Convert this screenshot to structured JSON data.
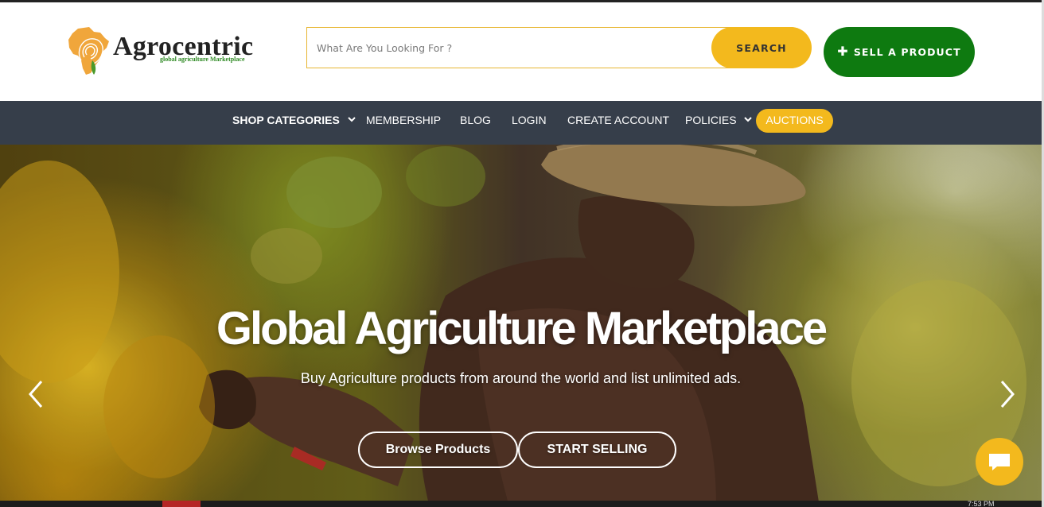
{
  "brand": {
    "name": "Agrocentric",
    "tagline": "global agriculture Marketplace"
  },
  "search": {
    "placeholder": "What Are You Looking For ?",
    "button_label": "SEARCH"
  },
  "header": {
    "sell_label": "SELL A PRODUCT",
    "sell_icon": "plus-icon"
  },
  "nav": {
    "items": [
      {
        "label": "SHOP CATEGORIES",
        "dropdown": true
      },
      {
        "label": "MEMBERSHIP"
      },
      {
        "label": "BLOG"
      },
      {
        "label": "LOGIN"
      },
      {
        "label": "CREATE ACCOUNT"
      },
      {
        "label": "POLICIES",
        "dropdown": true
      },
      {
        "label": "AUCTIONS",
        "highlight": true
      }
    ]
  },
  "hero": {
    "title": "Global Agriculture Marketplace",
    "subtitle": "Buy Agriculture products from around the world and list unlimited ads.",
    "browse_label": "Browse Products",
    "start_label": "START SELLING"
  },
  "colors": {
    "accent_yellow": "#f3b91d",
    "sell_green": "#0e7a10",
    "nav_bg": "#363e4a"
  },
  "footer_strip": {
    "clock": "7:53 PM"
  }
}
